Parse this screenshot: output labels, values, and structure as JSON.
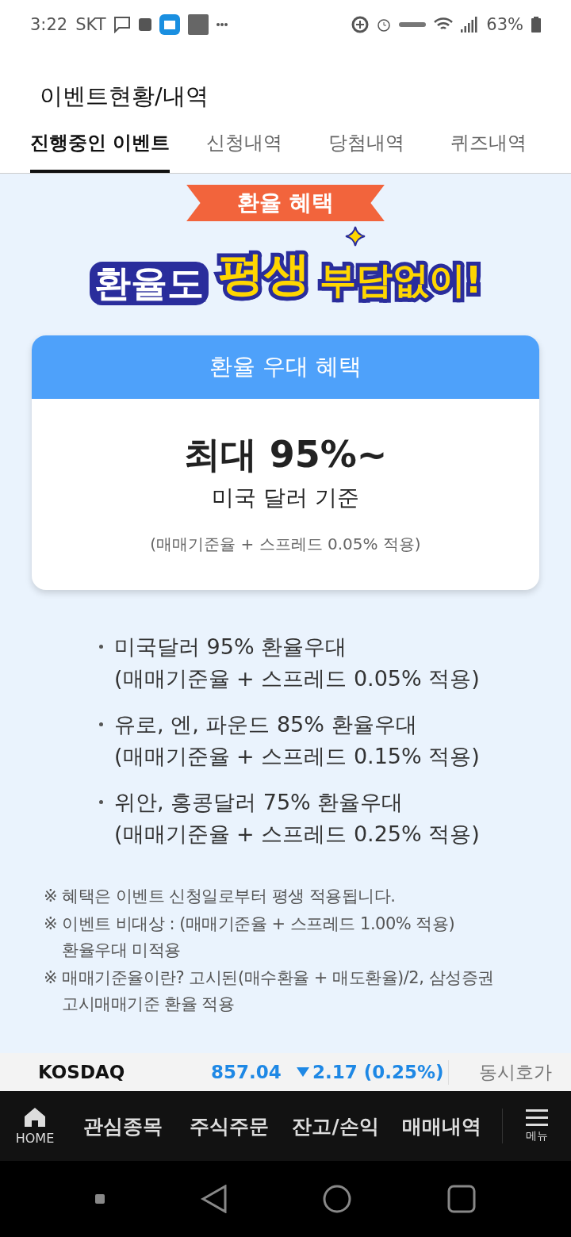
{
  "status_bar": {
    "time": "3:22",
    "carrier": "SKT",
    "battery": "63%"
  },
  "header": {
    "title": "이벤트현황/내역"
  },
  "tabs": [
    {
      "label": "진행중인 이벤트",
      "selected": true
    },
    {
      "label": "신청내역",
      "selected": false
    },
    {
      "label": "당첨내역",
      "selected": false
    },
    {
      "label": "퀴즈내역",
      "selected": false
    }
  ],
  "banner": {
    "ribbon": "환율 혜택",
    "headline": [
      {
        "text": "환율도",
        "kind": "plain"
      },
      {
        "text": "평생",
        "kind": "big"
      },
      {
        "text": "부담없이!",
        "kind": "accent"
      }
    ]
  },
  "card": {
    "title": "환율 우대 혜택",
    "rate": "최대 95%~",
    "basis": "미국 달러 기준",
    "note": "(매매기준율 + 스프레드 0.05% 적용)"
  },
  "bullets": [
    {
      "line1": "미국달러 95% 환율우대",
      "line2": "(매매기준율 + 스프레드 0.05% 적용)"
    },
    {
      "line1": "유로, 엔, 파운드 85% 환율우대",
      "line2": "(매매기준율 + 스프레드 0.15% 적용)"
    },
    {
      "line1": "위안, 홍콩달러 75% 환율우대",
      "line2": "(매매기준율 + 스프레드 0.25% 적용)"
    }
  ],
  "notes": [
    {
      "mark": "※",
      "lines": [
        "혜택은 이벤트 신청일로부터 평생 적용됩니다."
      ]
    },
    {
      "mark": "※",
      "lines": [
        "이벤트 비대상 : (매매기준율 + 스프레드 1.00% 적용)",
        "환율우대 미적용"
      ]
    },
    {
      "mark": "※",
      "lines": [
        "매매기준율이란? 고시된(매수환율 + 매도환율)/2, 삼성증권",
        "고시매매기준 환율 적용"
      ]
    }
  ],
  "ticker": {
    "name": "KOSDAQ",
    "value": "857.04",
    "change": "2.17 (0.25%)",
    "down": true,
    "session": "동시호가"
  },
  "bottom_nav": {
    "home": "HOME",
    "items": [
      "관심종목",
      "주식주문",
      "잔고/손익",
      "매매내역"
    ],
    "menu": "메뉴"
  }
}
